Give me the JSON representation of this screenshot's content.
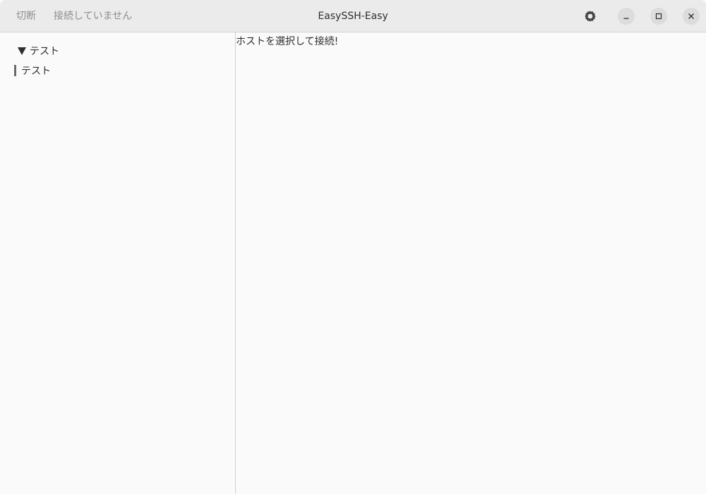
{
  "header": {
    "disconnect_label": "切断",
    "status_label": "接続していません",
    "title": "EasySSH-Easy",
    "menu_icon": "gear-icon",
    "minimize_icon": "minimize-icon",
    "maximize_icon": "maximize-icon",
    "close_icon": "close-icon"
  },
  "sidebar": {
    "group": {
      "label": "テスト",
      "expanded": true,
      "icon": "triangle-down-icon"
    },
    "hosts": [
      {
        "label": "テスト"
      }
    ]
  },
  "content": {
    "message": "ホストを選択して接続!"
  },
  "colors": {
    "headerbar_bg": "#ebebeb",
    "window_bg": "#fafafa",
    "text": "#2e2e2e",
    "dim_text": "#8e8e8e",
    "window_button_bg": "#dcdcdc"
  }
}
